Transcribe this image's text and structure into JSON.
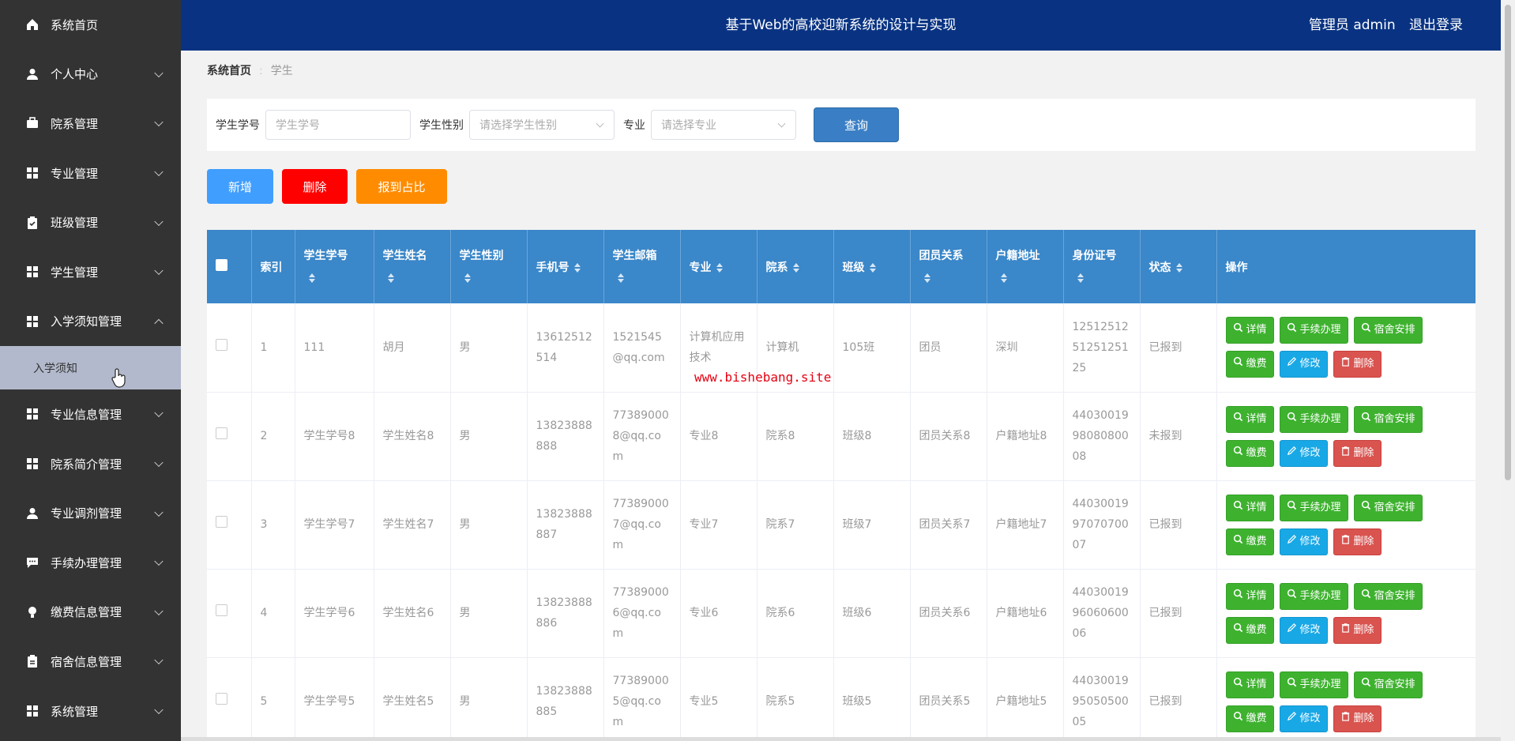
{
  "sidebar": {
    "items": [
      {
        "label": "系统首页",
        "icon": "home-icon",
        "chevron": false
      },
      {
        "label": "个人中心",
        "icon": "user-icon",
        "chevron": true
      },
      {
        "label": "院系管理",
        "icon": "briefcase-icon",
        "chevron": true
      },
      {
        "label": "专业管理",
        "icon": "grid-icon",
        "chevron": true
      },
      {
        "label": "班级管理",
        "icon": "clipboard-check-icon",
        "chevron": true
      },
      {
        "label": "学生管理",
        "icon": "grid-icon",
        "chevron": true
      },
      {
        "label": "入学须知管理",
        "icon": "grid-icon",
        "chevron": true,
        "expanded": true
      },
      {
        "label": "专业信息管理",
        "icon": "grid-icon",
        "chevron": true
      },
      {
        "label": "院系简介管理",
        "icon": "grid-icon",
        "chevron": true
      },
      {
        "label": "专业调剂管理",
        "icon": "user-icon",
        "chevron": true
      },
      {
        "label": "手续办理管理",
        "icon": "chat-icon",
        "chevron": true
      },
      {
        "label": "缴费信息管理",
        "icon": "bulb-icon",
        "chevron": true
      },
      {
        "label": "宿舍信息管理",
        "icon": "clipboard-icon",
        "chevron": true
      },
      {
        "label": "系统管理",
        "icon": "grid-icon",
        "chevron": true
      }
    ],
    "submenu": {
      "label": "入学须知"
    }
  },
  "header": {
    "title": "基于Web的高校迎新系统的设计与实现",
    "user_label": "管理员 admin",
    "logout_label": "退出登录"
  },
  "breadcrumb": {
    "home": "系统首页",
    "current": "学生"
  },
  "search": {
    "student_no_label": "学生学号",
    "student_no_placeholder": "学生学号",
    "gender_label": "学生性别",
    "gender_placeholder": "请选择学生性别",
    "major_label": "专业",
    "major_placeholder": "请选择专业",
    "query_label": "查询"
  },
  "actions": {
    "add": "新增",
    "delete": "删除",
    "ratio": "报到占比"
  },
  "table": {
    "headers": [
      "索引",
      "学生学号",
      "学生姓名",
      "学生性别",
      "手机号",
      "学生邮箱",
      "专业",
      "院系",
      "班级",
      "团员关系",
      "户籍地址",
      "身份证号",
      "状态",
      "操作"
    ],
    "op_labels": {
      "detail": "详情",
      "procedure": "手续办理",
      "dorm": "宿舍安排",
      "fee": "缴费",
      "edit": "修改",
      "delete": "删除"
    },
    "rows": [
      {
        "index": "1",
        "no": "111",
        "name": "胡月",
        "gender": "男",
        "phone": "13612512514",
        "email": "1521545@qq.com",
        "major": "计算机应用技术",
        "dept": "计算机",
        "class": "105班",
        "league": "团员",
        "address": "深圳",
        "idcard": "125125125125125125",
        "status": "已报到"
      },
      {
        "index": "2",
        "no": "学生学号8",
        "name": "学生姓名8",
        "gender": "男",
        "phone": "13823888888",
        "email": "773890008@qq.com",
        "major": "专业8",
        "dept": "院系8",
        "class": "班级8",
        "league": "团员关系8",
        "address": "户籍地址8",
        "idcard": "440300199808080008",
        "status": "未报到"
      },
      {
        "index": "3",
        "no": "学生学号7",
        "name": "学生姓名7",
        "gender": "男",
        "phone": "13823888887",
        "email": "773890007@qq.com",
        "major": "专业7",
        "dept": "院系7",
        "class": "班级7",
        "league": "团员关系7",
        "address": "户籍地址7",
        "idcard": "440300199707070007",
        "status": "已报到"
      },
      {
        "index": "4",
        "no": "学生学号6",
        "name": "学生姓名6",
        "gender": "男",
        "phone": "13823888886",
        "email": "773890006@qq.com",
        "major": "专业6",
        "dept": "院系6",
        "class": "班级6",
        "league": "团员关系6",
        "address": "户籍地址6",
        "idcard": "440300199606060006",
        "status": "已报到"
      },
      {
        "index": "5",
        "no": "学生学号5",
        "name": "学生姓名5",
        "gender": "男",
        "phone": "13823888885",
        "email": "773890005@qq.com",
        "major": "专业5",
        "dept": "院系5",
        "class": "班级5",
        "league": "团员关系5",
        "address": "户籍地址5",
        "idcard": "440300199505050005",
        "status": "已报到"
      }
    ]
  },
  "watermark": "www.bishebang.site",
  "colors": {
    "sidebar": "#333333",
    "header": "#093382",
    "table_head": "#3a87c9",
    "add": "#409eff",
    "delete": "#ff0000",
    "ratio": "#ff8c00",
    "submenu": "#b2b9cc"
  }
}
